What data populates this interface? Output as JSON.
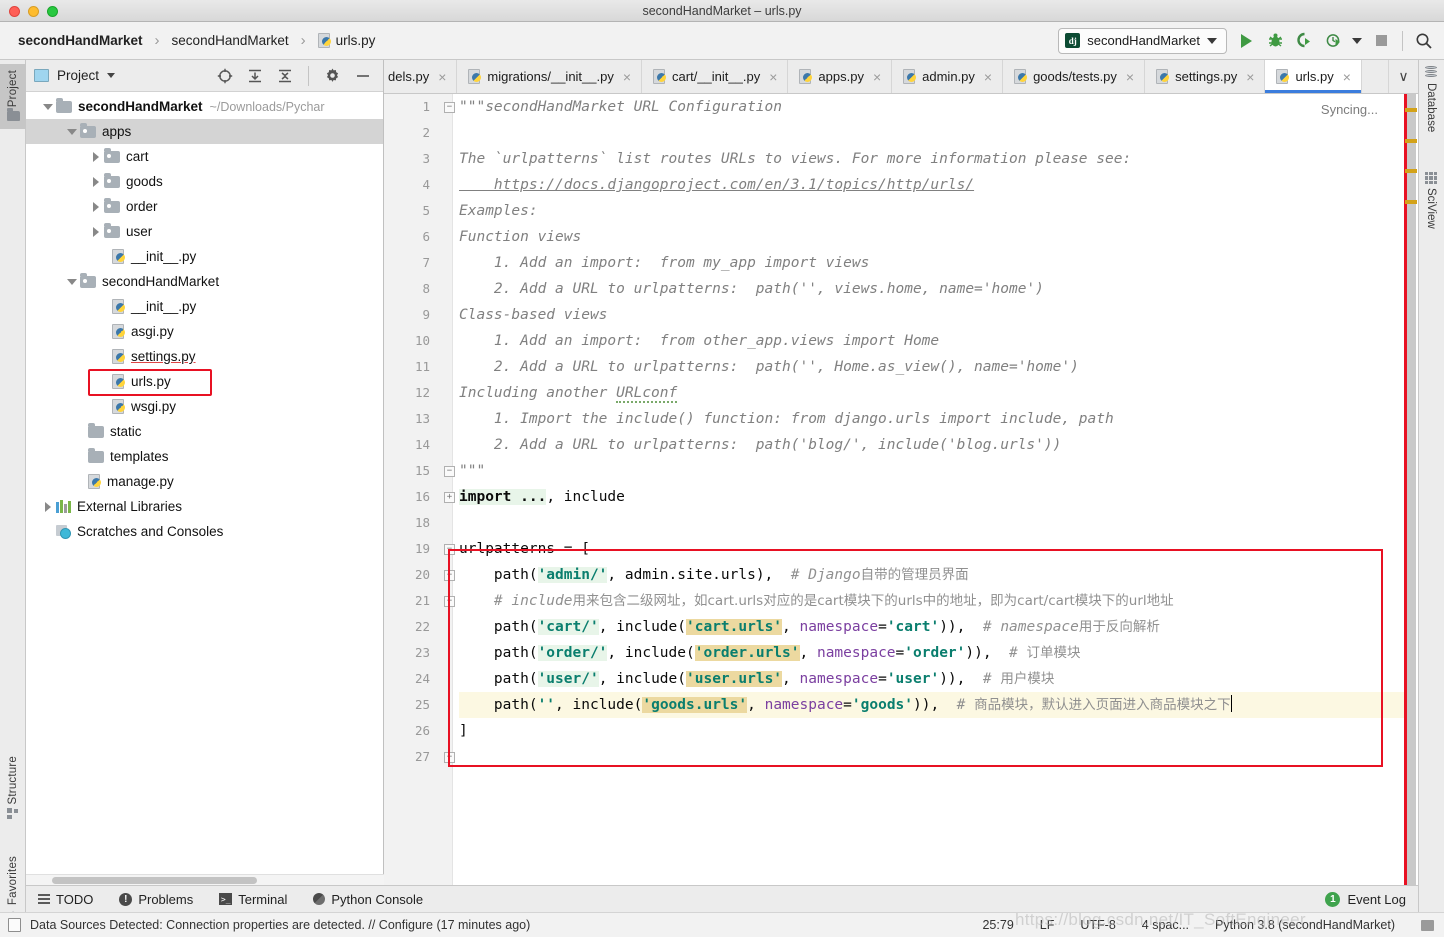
{
  "window": {
    "title": "secondHandMarket – urls.py"
  },
  "breadcrumb": {
    "items": [
      "secondHandMarket",
      "secondHandMarket",
      "urls.py"
    ],
    "separator": "›"
  },
  "toolbar": {
    "run_config": "secondHandMarket",
    "django_badge": "dj",
    "icons": [
      "run-icon",
      "debug-icon",
      "coverage-icon",
      "profile-icon",
      "profile-dropdown-icon",
      "stop-icon",
      "search-everywhere-icon"
    ]
  },
  "left_strip": {
    "tabs": [
      {
        "label": "Project",
        "icon": "folder-icon",
        "selected": true
      },
      {
        "label": "Structure",
        "icon": "structure-icon",
        "selected": false
      },
      {
        "label": "Favorites",
        "icon": "star-icon",
        "selected": false
      }
    ]
  },
  "right_strip": {
    "tabs": [
      {
        "label": "Database",
        "icon": "database-icon"
      },
      {
        "label": "SciView",
        "icon": "grid-icon"
      }
    ]
  },
  "project_panel": {
    "title": "Project",
    "header_icons": [
      "locate-icon",
      "expand-all-icon",
      "collapse-all-icon",
      "settings-gear-icon",
      "hide-icon"
    ],
    "tree": [
      {
        "depth": 0,
        "arrow": "down",
        "type": "folder-root",
        "label": "secondHandMarket",
        "bold": true,
        "path": "~/Downloads/Pychar",
        "selected": false
      },
      {
        "depth": 1,
        "arrow": "down",
        "type": "folder",
        "label": "apps",
        "bold": false,
        "selected": true
      },
      {
        "depth": 2,
        "arrow": "right",
        "type": "folder",
        "label": "cart",
        "bold": false,
        "selected": false
      },
      {
        "depth": 2,
        "arrow": "right",
        "type": "folder",
        "label": "goods",
        "bold": false,
        "selected": false
      },
      {
        "depth": 2,
        "arrow": "right",
        "type": "folder",
        "label": "order",
        "bold": false,
        "selected": false
      },
      {
        "depth": 2,
        "arrow": "right",
        "type": "folder",
        "label": "user",
        "bold": false,
        "selected": false
      },
      {
        "depth": 3,
        "arrow": "none",
        "type": "python",
        "label": "__init__.py",
        "bold": false,
        "selected": false
      },
      {
        "depth": 1,
        "arrow": "down",
        "type": "folder",
        "label": "secondHandMarket",
        "bold": false,
        "selected": false
      },
      {
        "depth": 3,
        "arrow": "none",
        "type": "python",
        "label": "__init__.py",
        "bold": false,
        "selected": false
      },
      {
        "depth": 3,
        "arrow": "none",
        "type": "python",
        "label": "asgi.py",
        "bold": false,
        "selected": false
      },
      {
        "depth": 3,
        "arrow": "none",
        "type": "python",
        "label": "settings.py",
        "bold": false,
        "selected": false,
        "underlined": true
      },
      {
        "depth": 3,
        "arrow": "none",
        "type": "python",
        "label": "urls.py",
        "bold": false,
        "selected": false,
        "highlighted": true
      },
      {
        "depth": 3,
        "arrow": "none",
        "type": "python",
        "label": "wsgi.py",
        "bold": false,
        "selected": false
      },
      {
        "depth": 2,
        "arrow": "none",
        "type": "plainfolder",
        "label": "static",
        "bold": false,
        "selected": false
      },
      {
        "depth": 2,
        "arrow": "none",
        "type": "plainfolder",
        "label": "templates",
        "bold": false,
        "selected": false
      },
      {
        "depth": 2,
        "arrow": "none",
        "type": "python",
        "label": "manage.py",
        "bold": false,
        "selected": false
      },
      {
        "depth": 0,
        "arrow": "right",
        "type": "libraries",
        "label": "External Libraries",
        "bold": false,
        "selected": false
      },
      {
        "depth": 0,
        "arrow": "none",
        "type": "scratches",
        "label": "Scratches and Consoles",
        "bold": false,
        "selected": false
      }
    ]
  },
  "editor_tabs": {
    "items": [
      {
        "label": "dels.py",
        "clipped": true,
        "active": false,
        "icon": "none"
      },
      {
        "label": "migrations/__init__.py",
        "clipped": false,
        "active": false,
        "icon": "python-file-icon"
      },
      {
        "label": "cart/__init__.py",
        "clipped": false,
        "active": false,
        "icon": "python-file-icon"
      },
      {
        "label": "apps.py",
        "clipped": false,
        "active": false,
        "icon": "python-file-icon"
      },
      {
        "label": "admin.py",
        "clipped": false,
        "active": false,
        "icon": "python-file-icon"
      },
      {
        "label": "goods/tests.py",
        "clipped": false,
        "active": false,
        "icon": "python-file-icon"
      },
      {
        "label": "settings.py",
        "clipped": false,
        "active": false,
        "icon": "python-file-icon"
      },
      {
        "label": "urls.py",
        "clipped": false,
        "active": true,
        "icon": "python-file-icon"
      }
    ],
    "close_glyph": "×",
    "overflow_glyph": "∨"
  },
  "editor": {
    "syncing_text": "Syncing...",
    "accent_blue": "#3b7ddd",
    "highlight_red": "#e81123",
    "string_color": "#0a7e6e",
    "comment_color": "#909090",
    "kwarg_color": "#7b3fa0",
    "current_line": 25,
    "lines": [
      {
        "n": 1,
        "fold": "minus"
      },
      {
        "n": 2,
        "fold": ""
      },
      {
        "n": 3,
        "fold": ""
      },
      {
        "n": 4,
        "fold": ""
      },
      {
        "n": 5,
        "fold": ""
      },
      {
        "n": 6,
        "fold": ""
      },
      {
        "n": 7,
        "fold": ""
      },
      {
        "n": 8,
        "fold": ""
      },
      {
        "n": 9,
        "fold": ""
      },
      {
        "n": 10,
        "fold": ""
      },
      {
        "n": 11,
        "fold": ""
      },
      {
        "n": 12,
        "fold": ""
      },
      {
        "n": 13,
        "fold": ""
      },
      {
        "n": 14,
        "fold": ""
      },
      {
        "n": 15,
        "fold": ""
      },
      {
        "n": 16,
        "fold": "plus"
      },
      {
        "n": 18,
        "fold": ""
      },
      {
        "n": 19,
        "fold": "minus"
      },
      {
        "n": 20,
        "fold": "minus"
      },
      {
        "n": 21,
        "fold": "minus"
      },
      {
        "n": 22,
        "fold": ""
      },
      {
        "n": 23,
        "fold": ""
      },
      {
        "n": 24,
        "fold": ""
      },
      {
        "n": 25,
        "fold": ""
      },
      {
        "n": 26,
        "fold": ""
      },
      {
        "n": 27,
        "fold": ""
      }
    ],
    "code": {
      "l1": "\"\"\"secondHandMarket URL Configuration",
      "l2": "",
      "l3": "The `urlpatterns` list routes URLs to views. For more information please see:",
      "l4": "    https://docs.djangoproject.com/en/3.1/topics/http/urls/",
      "l5": "Examples:",
      "l6": "Function views",
      "l7": "    1. Add an import:  from my_app import views",
      "l8": "    2. Add a URL to urlpatterns:  path('', views.home, name='home')",
      "l9": "Class-based views",
      "l10": "    1. Add an import:  from other_app.views import Home",
      "l11": "    2. Add a URL to urlpatterns:  path('', Home.as_view(), name='home')",
      "l12a": "Including another ",
      "l12b": "URLconf",
      "l13": "    1. Import the include() function: from django.urls import include, path",
      "l14": "    2. Add a URL to urlpatterns:  path('blog/', include('blog.urls'))",
      "l15": "\"\"\"",
      "l16_kw": "import ...",
      "l16_rest": ", include",
      "l19": "urlpatterns = [",
      "l20_a": "    path(",
      "l20_str": "'admin/'",
      "l20_b": ", admin.site.urls),  ",
      "l20_cmt": "# Django",
      "l20_cmt_cn": "自带的管理员界面",
      "l21_cmt": "    # include",
      "l21_cmt_cn": "用来包含二级网址，如cart.urls对应的是cart模块下的urls中的地址，即为cart/cart模块下的url地址",
      "l22_a": "    path(",
      "l22_s1": "'cart/'",
      "l22_b": ", include(",
      "l22_s2": "'cart.urls'",
      "l22_c": ", ",
      "l22_kwarg": "namespace",
      "l22_eq": "=",
      "l22_s3": "'cart'",
      "l22_d": ")),  ",
      "l22_cmt": "# namespace",
      "l22_cmt_cn": "用于反向解析",
      "l23_a": "    path(",
      "l23_s1": "'order/'",
      "l23_b": ", include(",
      "l23_s2": "'order.urls'",
      "l23_c": ", ",
      "l23_kwarg": "namespace",
      "l23_eq": "=",
      "l23_s3": "'order'",
      "l23_d": ")),  ",
      "l23_cmt": "# ",
      "l23_cmt_cn": "订单模块",
      "l24_a": "    path(",
      "l24_s1": "'user/'",
      "l24_b": ", include(",
      "l24_s2": "'user.urls'",
      "l24_c": ", ",
      "l24_kwarg": "namespace",
      "l24_eq": "=",
      "l24_s3": "'user'",
      "l24_d": ")),  ",
      "l24_cmt": "# ",
      "l24_cmt_cn": "用户模块",
      "l25_a": "    path(",
      "l25_s1": "''",
      "l25_b": ", include(",
      "l25_s2": "'goods.urls'",
      "l25_c": ", ",
      "l25_kwarg": "namespace",
      "l25_eq": "=",
      "l25_s3": "'goods'",
      "l25_d": ")),  ",
      "l25_cmt": "# ",
      "l25_cmt_cn": "商品模块，默认进入页面进入商品模块之下",
      "l26": "]"
    }
  },
  "bottom_bar": {
    "items": [
      {
        "label": "TODO",
        "icon": "todo-icon"
      },
      {
        "label": "Problems",
        "icon": "problems-icon"
      },
      {
        "label": "Terminal",
        "icon": "terminal-icon"
      },
      {
        "label": "Python Console",
        "icon": "python-console-icon"
      }
    ],
    "event_log": {
      "label": "Event Log",
      "count": "1"
    }
  },
  "status_bar": {
    "message": "Data Sources Detected: Connection properties are detected. // Configure (17 minutes ago)",
    "caret_position": "25:79",
    "line_separator": "LF",
    "encoding": "UTF-8",
    "indent": "4 spac...",
    "interpreter": "Python 3.8 (secondHandMarket)"
  },
  "watermark": {
    "text": "https://blog.csdn.net/IT_SoftEngineer"
  }
}
